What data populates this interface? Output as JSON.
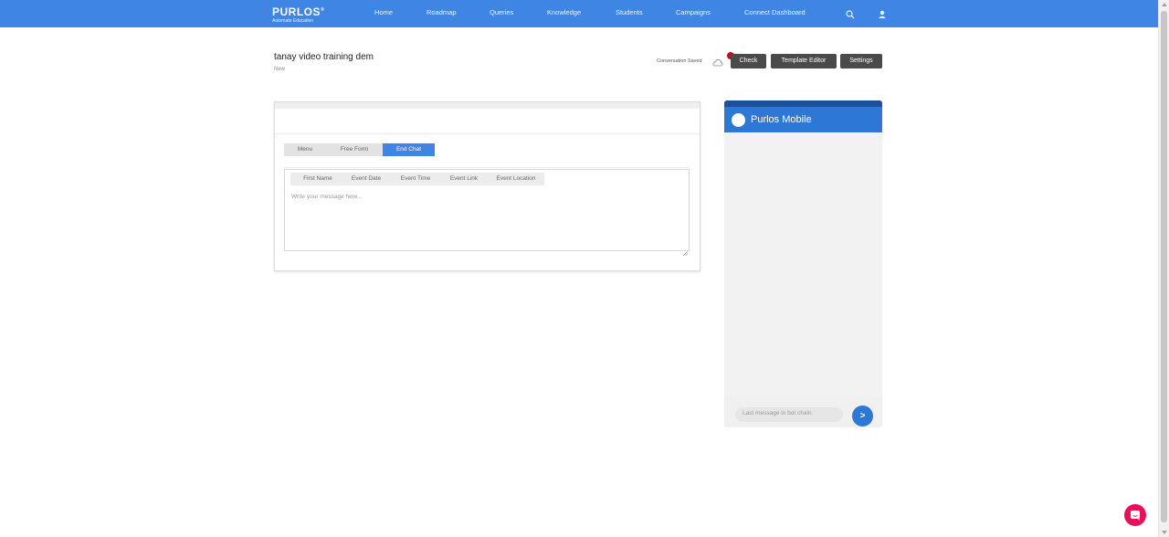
{
  "brand": {
    "name": "PURLOS",
    "mark": "®",
    "tagline": "Automate Education"
  },
  "nav": {
    "items": [
      "Home",
      "Roadmap",
      "Queries",
      "Knowledge",
      "Students",
      "Campaigns",
      "Connect Dashboard"
    ],
    "icons": [
      "search-icon",
      "user-icon"
    ]
  },
  "page": {
    "title": "tanay video training dem",
    "status": "New"
  },
  "toolbar": {
    "saved_text": "Conversation Saved",
    "check_label": "Check",
    "template_editor_label": "Template Editor",
    "settings_label": "Settings"
  },
  "editor": {
    "tabs": [
      {
        "label": "Menu",
        "active": false
      },
      {
        "label": "Free Form",
        "active": false
      },
      {
        "label": "End Chat",
        "active": true
      }
    ],
    "variables": [
      "First Name",
      "Event Date",
      "Event Time",
      "Event Link",
      "Event Location"
    ],
    "message_placeholder": "Write your message here..."
  },
  "mobile": {
    "title": "Purlos Mobile",
    "input_text": "Last message in bot chain.",
    "send_label": ">"
  },
  "colors": {
    "nav_bg": "#3f86e4",
    "accent": "#3f86e4",
    "mobile_header": "#2d78d6",
    "dark_button": "#4a4a4a",
    "notification": "#d0021b",
    "chat_widget": "#e8105a"
  }
}
